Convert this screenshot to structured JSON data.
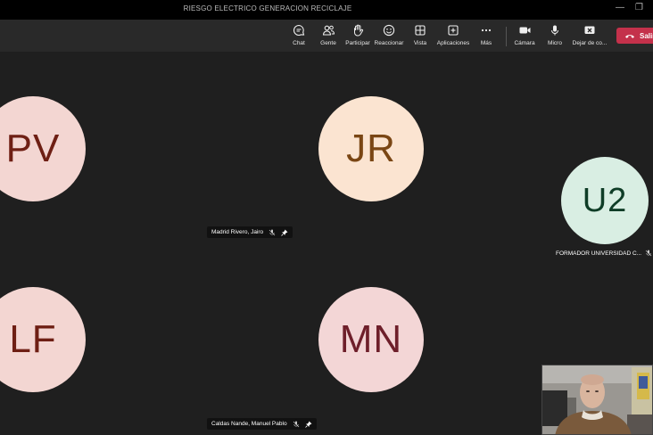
{
  "window": {
    "title": "RIESGO ELECTRICO GENERACION RECICLAJE",
    "minimize_glyph": "—",
    "restore_glyph": "❐"
  },
  "toolbar": {
    "items": [
      {
        "label": "Chat",
        "icon": "chat-icon"
      },
      {
        "label": "Gente",
        "icon": "people-icon"
      },
      {
        "label": "Participar",
        "icon": "raise-hand-icon"
      },
      {
        "label": "Reaccionar",
        "icon": "smiley-icon"
      },
      {
        "label": "Vista",
        "icon": "grid-view-icon"
      },
      {
        "label": "Aplicaciones",
        "icon": "plus-square-icon"
      },
      {
        "label": "Más",
        "icon": "more-icon"
      },
      {
        "label": "Cámara",
        "icon": "camera-icon"
      },
      {
        "label": "Micro",
        "icon": "mic-icon"
      },
      {
        "label": "Dejar de co...",
        "icon": "stop-share-icon"
      }
    ],
    "leave": {
      "label": "Salir",
      "icon": "hangup-icon",
      "color": "#c4314b"
    }
  },
  "participants": [
    {
      "initials": "PV",
      "bg": "#f3d6d2",
      "fg": "#6e1f14"
    },
    {
      "initials": "JR",
      "bg": "#fbe4d1",
      "fg": "#7a4614"
    },
    {
      "initials": "U2",
      "bg": "#d9eee3",
      "fg": "#0f3d27"
    },
    {
      "initials": "LF",
      "bg": "#f3d6d2",
      "fg": "#6e1f14"
    },
    {
      "initials": "MN",
      "bg": "#f3d6d6",
      "fg": "#6e1f2a"
    }
  ],
  "name_tags": {
    "madrid": "Madrid Rivero, Jairo",
    "formador": "FORMADOR UNIVERSIDAD C...",
    "caldas": "Caldas Nande, Manuel Pablo"
  }
}
